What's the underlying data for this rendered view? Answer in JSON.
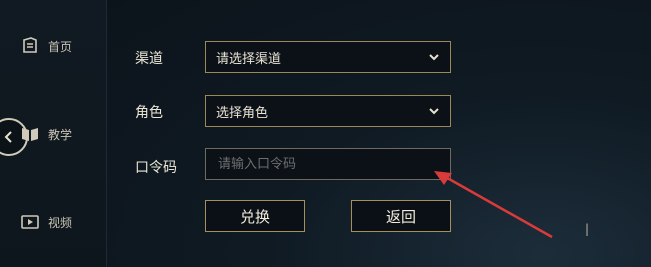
{
  "sidebar": {
    "items": [
      {
        "label": "首页",
        "icon": "home-icon"
      },
      {
        "label": "教学",
        "icon": "book-icon"
      },
      {
        "label": "视频",
        "icon": "video-icon"
      }
    ],
    "back_icon": "chevron-left-icon"
  },
  "form": {
    "channel": {
      "label": "渠道",
      "value": "请选择渠道"
    },
    "role": {
      "label": "角色",
      "value": "选择角色"
    },
    "code": {
      "label": "口令码",
      "placeholder": "请输入口令码",
      "value": ""
    }
  },
  "buttons": {
    "redeem_label": "兑换",
    "back_label": "返回"
  },
  "colors": {
    "accent_border": "#9c8756",
    "annotation_arrow": "#d93a3a"
  }
}
